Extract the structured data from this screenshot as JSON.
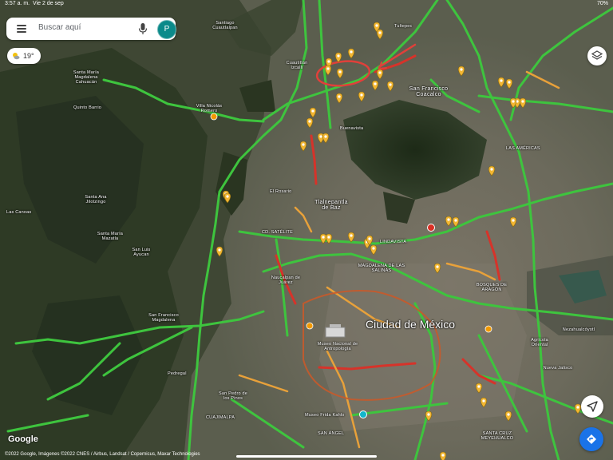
{
  "status_bar": {
    "time": "3:57 a. m.",
    "date": "Vie 2 de sep",
    "battery": "70%"
  },
  "search": {
    "placeholder": "Buscar aquí",
    "avatar_letter": "P"
  },
  "weather": {
    "temperature": "19°",
    "icon": "partly-cloudy-icon"
  },
  "logo": "Google",
  "attribution": "©2022 Google, Imágenes ©2022 CNES / Airbus, Landsat / Copernicus, Maxar Technologies",
  "map_labels": {
    "ciudad_de_mexico": "Ciudad de México",
    "tlalnepantla": "Tlalnepantla de Baz",
    "san_francisco_coacalco": "San Francisco Coacalco",
    "magdalena_de_las_salinas": "MAGDALENA DE LAS SALINAS",
    "las_americas": "LAS AMÉRICAS",
    "bosques_de_aragon": "BOSQUES DE ARAGÓN",
    "lindavista": "LINDAVISTA",
    "cd_satelite": "CD. SATÉLITE",
    "naucalpan": "Naucalpan de Juárez",
    "cuajimalpa": "CUAJIMALPA",
    "santa_cruz_meyehualco": "SANTA CRUZ MEYEHUALCO",
    "museo_antropologia": "Museo Nacional de Antropología",
    "museo_frida": "Museo Frida Kahlo",
    "san_francisco_magdalena": "San Francisco Magdalena",
    "santa_maria_magdalena": "Santa María Magdalena Cahuacán",
    "quinto_barrio": "Quinto Barrio",
    "las_canoas": "Las Canoas",
    "santa_ana_jilotzingo": "Santa Ana Jilotzingo",
    "santa_maria_mazatla": "Santa María Mazatla",
    "san_luis_ayucan": "San Luis Ayucan",
    "villa_nicolas_romero": "Villa Nicolás Romero",
    "cuautitlan_izcalli": "Cuautitlán Izcalli",
    "tultepec": "Tultepec",
    "santiago_cuautlalpan": "Santiago Cuautlalpan",
    "el_rosario": "El Rosario",
    "buenavista": "Buenavista",
    "san_pedro_de_los_pinos": "San Pedro de los Pinos",
    "san_angel": "SAN ÁNGEL",
    "nezahualcoyotl": "Nezahualcóyotl",
    "agricola_oriental": "Agrícola Oriental",
    "nueva_jalisco": "Nueva Jalisco",
    "pedregal": "Pedregal"
  },
  "colors": {
    "traffic_fast": "#3ec43e",
    "traffic_slow": "#e8a13a",
    "traffic_heavy": "#d6332a",
    "pin": "#f2b632",
    "circle": "#e0403a",
    "accent": "#1a73e8"
  }
}
